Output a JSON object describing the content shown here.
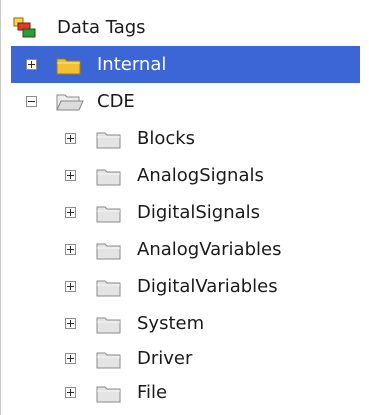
{
  "tree": {
    "root": {
      "label": "Data Tags",
      "icon": "data-tags-icon"
    },
    "internal": {
      "label": "Internal",
      "selected": true,
      "expanded": false
    },
    "cde": {
      "label": "CDE",
      "expanded": true,
      "children": [
        {
          "label": "Blocks"
        },
        {
          "label": "AnalogSignals"
        },
        {
          "label": "DigitalSignals"
        },
        {
          "label": "AnalogVariables"
        },
        {
          "label": "DigitalVariables"
        },
        {
          "label": "System"
        },
        {
          "label": "Driver"
        },
        {
          "label": "File"
        }
      ]
    }
  },
  "colors": {
    "selection": "#3c66d6",
    "folder_selected": "#f5c030",
    "folder_normal": "#e4e4e4"
  }
}
